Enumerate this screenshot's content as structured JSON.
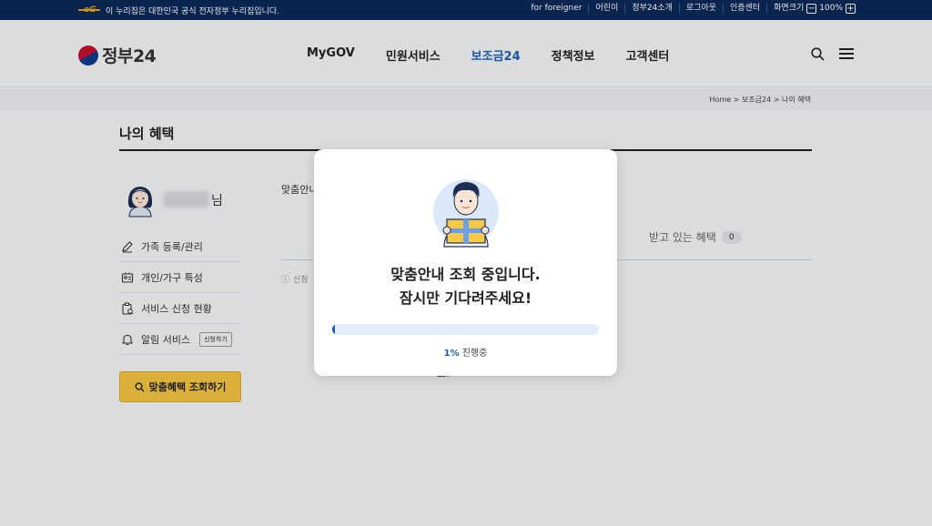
{
  "topbar": {
    "notice": "이 누리집은 대한민국 공식 전자정부 누리집입니다.",
    "links": [
      "for foreigner",
      "어린이",
      "정부24소개",
      "로그아웃",
      "인증센터"
    ],
    "zoom_label": "화면크기",
    "zoom_value": "100%",
    "zoom_minus": "−",
    "zoom_plus": "+"
  },
  "header": {
    "logo_text": "정부24",
    "nav": [
      "MyGOV",
      "민원서비스",
      "보조금24",
      "정책정보",
      "고객센터"
    ],
    "active_nav": "보조금24"
  },
  "breadcrumb": "Home  >  보조금24  >  나의 혜택",
  "page_title": "나의 혜택",
  "profile": {
    "suffix": "님"
  },
  "side_menu": [
    {
      "label": "가족 등록/관리",
      "icon": "pencil-icon"
    },
    {
      "label": "개인/가구 특성",
      "icon": "id-card-icon"
    },
    {
      "label": "서비스 신청 현황",
      "icon": "clipboard-icon"
    },
    {
      "label": "알림 서비스",
      "icon": "bell-icon",
      "chip": "신청하기"
    }
  ],
  "cta_label": "맞춤혜택 조회하기",
  "main": {
    "intro": "맞춤안내",
    "received_tab": "받고 있는 혜택",
    "received_count": "0",
    "info_text": "신청",
    "empty_text": "요."
  },
  "modal": {
    "line1": "맞춤안내 조회 중입니다.",
    "line2": "잠시만 기다려주세요!",
    "progress_percent": 1,
    "progress_pct_text": "1%",
    "progress_suffix": "진행중"
  },
  "colors": {
    "topbar_bg": "#0b2a59",
    "accent": "#1a5fb4",
    "cta": "#f4c542"
  }
}
